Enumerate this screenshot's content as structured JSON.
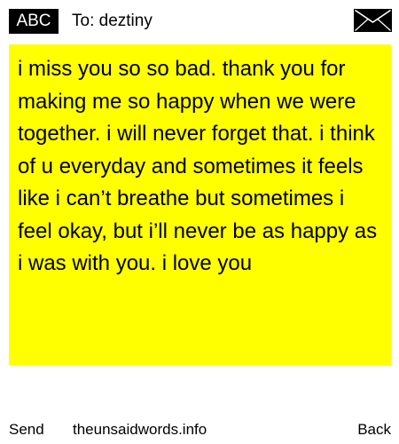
{
  "header": {
    "input_mode": "ABC",
    "recipient": "To: deztiny",
    "envelope_icon": "envelope-icon"
  },
  "message": {
    "body": "i miss you so so bad. thank you for making me so happy when we were together. i will never forget that. i think of u everyday and sometimes it feels like i can’t breathe but sometimes i feel okay, but i’ll never be as happy as i was with you. i love you",
    "background_color": "#ffff00"
  },
  "footer": {
    "send_label": "Send",
    "site_label": "theunsaidwords.info",
    "back_label": "Back"
  }
}
